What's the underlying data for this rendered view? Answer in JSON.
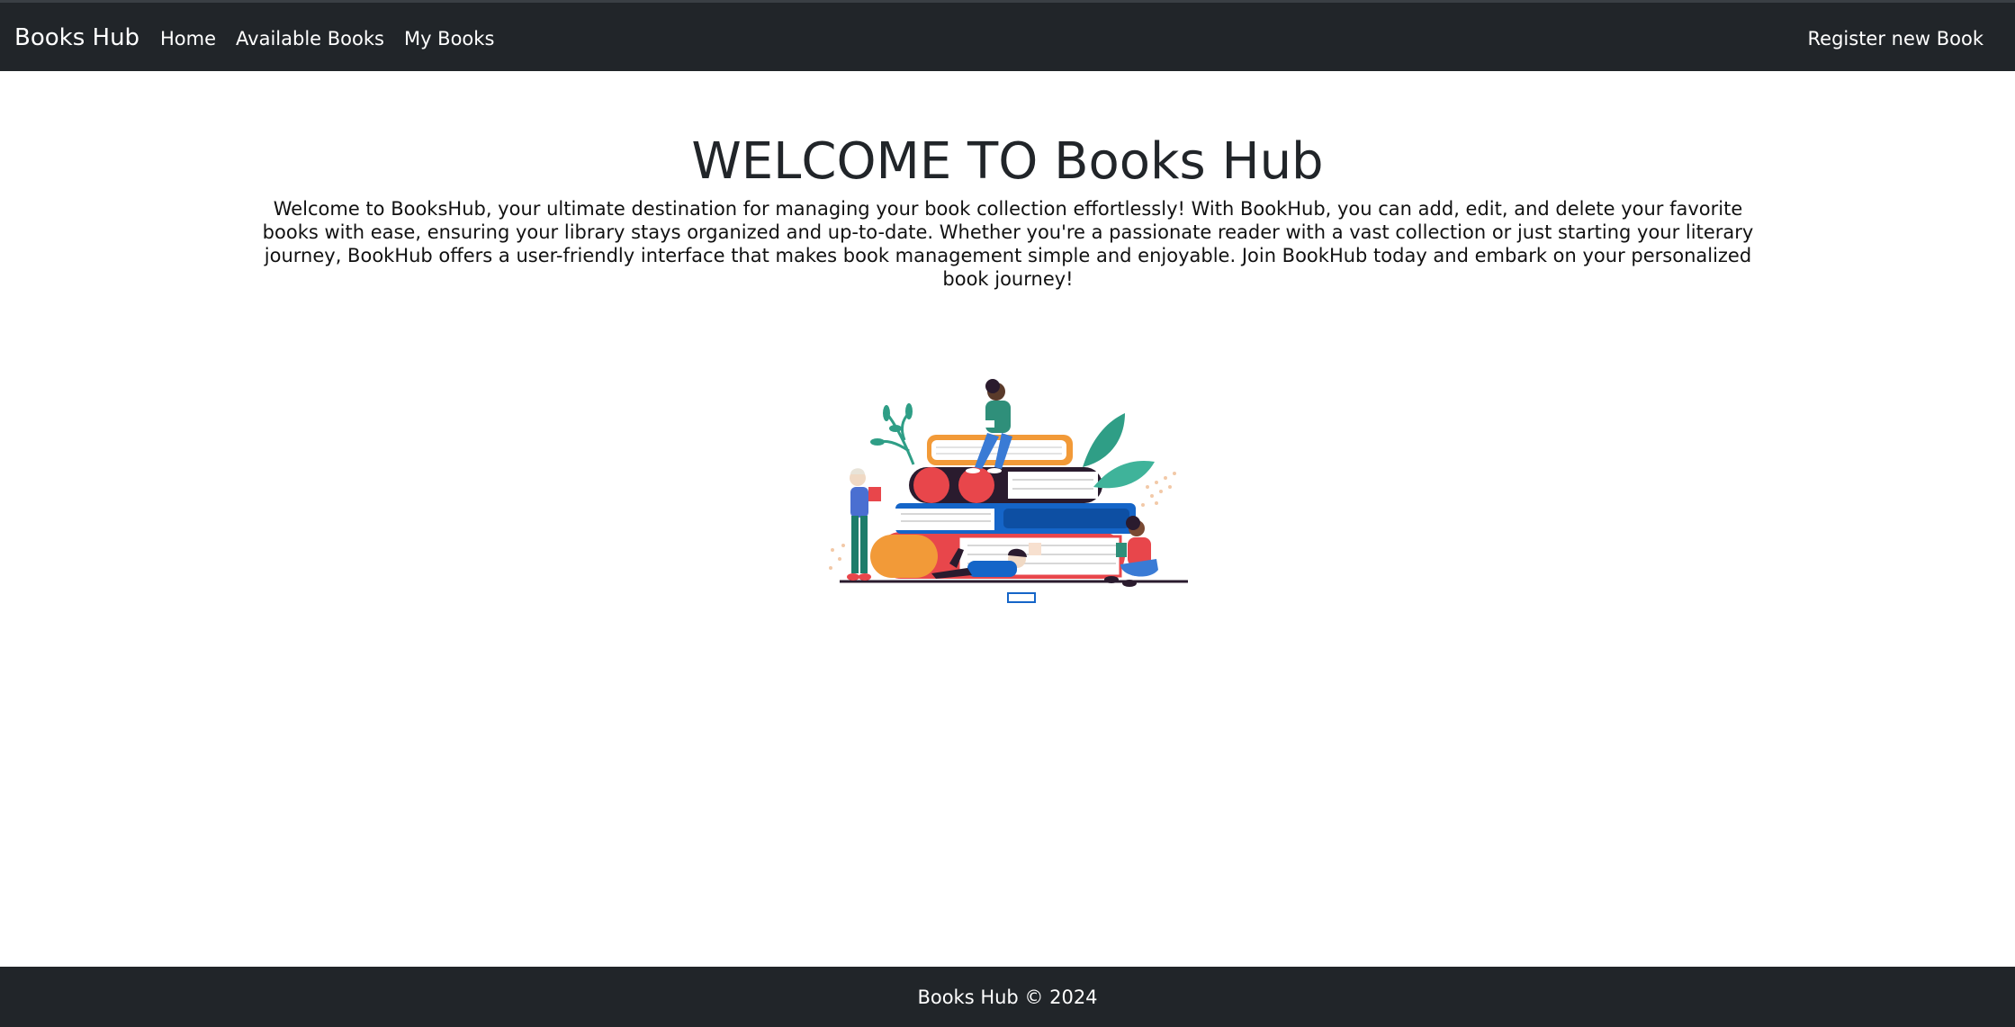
{
  "navbar": {
    "brand": "Books Hub",
    "links": [
      "Home",
      "Available Books",
      "My Books"
    ],
    "right_link": "Register new Book"
  },
  "main": {
    "title": "WELCOME TO Books Hub",
    "intro": "Welcome to BooksHub, your ultimate destination for managing your book collection effortlessly! With BookHub, you can add, edit, and delete your favorite books with ease, ensuring your library stays organized and up-to-date. Whether you're a passionate reader with a vast collection or just starting your literary journey, BookHub offers a user-friendly interface that makes book management simple and enjoyable. Join BookHub today and embark on your personalized book journey!",
    "illustration": "people-reading-on-book-stack-illustration"
  },
  "footer": {
    "text": "Books Hub © 2024"
  },
  "colors": {
    "navbar_bg": "#212529",
    "footer_bg": "#212529",
    "text_dark": "#212529",
    "book_red": "#e8464b",
    "book_orange": "#f29a38",
    "book_blue": "#1565c8",
    "book_dark": "#2a1b2e",
    "leaf_green": "#2f9e86"
  }
}
